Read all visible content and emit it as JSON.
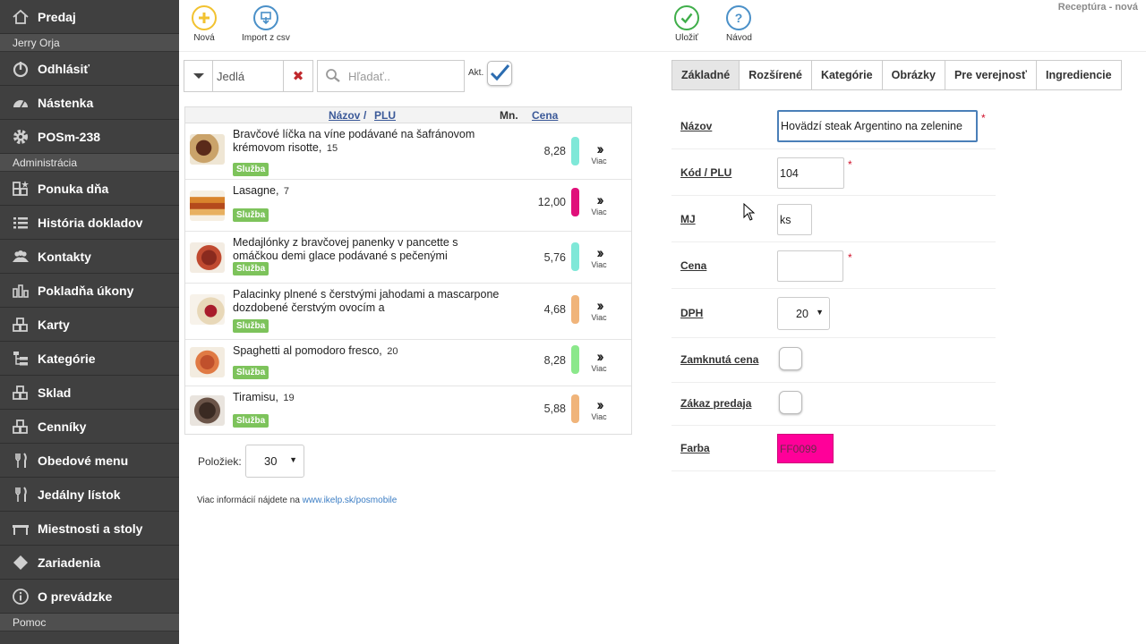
{
  "app": {
    "heading": "Receptúra - nová"
  },
  "sidebar": {
    "top_item": {
      "label": "Predaj",
      "icon": "home-icon"
    },
    "user_heading": "Jerry Orja",
    "logout": {
      "label": "Odhlásiť",
      "icon": "power-icon"
    },
    "dashboard": {
      "label": "Nástenka",
      "icon": "dashboard-icon"
    },
    "pos": {
      "label": "POSm-238",
      "icon": "gear-icon"
    },
    "admin_heading": "Administrácia",
    "admin_items": [
      {
        "label": "Ponuka dňa",
        "icon": "blocks-star-icon"
      },
      {
        "label": "História dokladov",
        "icon": "list-icon"
      },
      {
        "label": "Kontakty",
        "icon": "users-icon"
      },
      {
        "label": "Pokladňa úkony",
        "icon": "bar-chart-icon"
      },
      {
        "label": "Karty",
        "icon": "blocks-icon"
      },
      {
        "label": "Kategórie",
        "icon": "tree-icon"
      },
      {
        "label": "Sklad",
        "icon": "blocks-icon"
      },
      {
        "label": "Cenníky",
        "icon": "blocks-icon"
      },
      {
        "label": "Obedové menu",
        "icon": "fork-knife-icon"
      },
      {
        "label": "Jedálny lístok",
        "icon": "fork-knife-icon"
      },
      {
        "label": "Miestnosti a stoly",
        "icon": "table-icon"
      },
      {
        "label": "Zariadenia",
        "icon": "diamond-icon"
      },
      {
        "label": "O prevádzke",
        "icon": "info-icon"
      }
    ],
    "help_heading": "Pomoc"
  },
  "toolbar": {
    "new_label": "Nová",
    "import_label": "Import z csv",
    "save_label": "Uložiť",
    "help_label": "Návod"
  },
  "filter": {
    "category_value": "Jedlá",
    "search_placeholder": "Hľadať..",
    "active_label": "Akt.",
    "active_checked": true
  },
  "list": {
    "headers": {
      "name": "Názov",
      "sep": " / ",
      "plu": "PLU",
      "qty": "Mn.",
      "price": "Cena"
    },
    "rows": [
      {
        "name": "Bravčové líčka na víne podávané na šafránovom krémovom risotte,",
        "plu": "15",
        "badge": "Služba",
        "price": "8,28",
        "color": "#7fe8d8",
        "more": "Viac"
      },
      {
        "name": "Lasagne,",
        "plu": "7",
        "badge": "Služba",
        "price": "12,00",
        "color": "#e0107a",
        "more": "Viac"
      },
      {
        "name": "Medajlónky z bravčovej panenky v pancette s omáčkou demi glace podávané s pečenými",
        "plu": "",
        "badge": "Služba",
        "price": "5,76",
        "color": "#7fe8d8",
        "more": "Viac"
      },
      {
        "name": "Palacinky plnené s čerstvými jahodami a mascarpone dozdobené čerstvým ovocím a",
        "plu": "",
        "badge": "Služba",
        "price": "4,68",
        "color": "#f0b47a",
        "more": "Viac"
      },
      {
        "name": "Spaghetti al pomodoro fresco,",
        "plu": "20",
        "badge": "Služba",
        "price": "8,28",
        "color": "#8be88b",
        "more": "Viac"
      },
      {
        "name": "Tiramisu,",
        "plu": "19",
        "badge": "Služba",
        "price": "5,88",
        "color": "#f0b47a",
        "more": "Viac"
      }
    ],
    "count_label": "Položiek:",
    "count_value": "30",
    "info_text": "Viac informácií nájdete na ",
    "info_link": "www.ikelp.sk/posmobile"
  },
  "tabs": [
    {
      "label": "Základné",
      "active": true
    },
    {
      "label": "Rozšírené",
      "active": false
    },
    {
      "label": "Kategórie",
      "active": false
    },
    {
      "label": "Obrázky",
      "active": false
    },
    {
      "label": "Pre verejnosť",
      "active": false
    },
    {
      "label": "Ingrediencie",
      "active": false
    }
  ],
  "form": {
    "name_label": "Názov",
    "name_value": "Hovädzí steak Argentino na zelenine",
    "code_label": "Kód / PLU",
    "code_value": "104",
    "unit_label": "MJ",
    "unit_value": "ks",
    "price_label": "Cena",
    "price_value": "",
    "vat_label": "DPH",
    "vat_value": "20",
    "locked_price_label": "Zamknutá cena",
    "sale_ban_label": "Zákaz predaja",
    "color_label": "Farba",
    "color_value": "FF0099",
    "required_mark": "*",
    "color_hex": "#ff0099"
  }
}
